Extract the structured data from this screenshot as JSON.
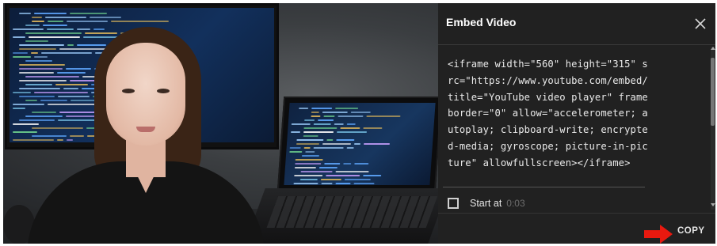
{
  "dialog": {
    "title": "Embed Video",
    "close_icon": "close-icon",
    "embed_code": "<iframe width=\"560\" height=\"315\" src=\"https://www.youtube.com/embed/ title=\"YouTube video player\" frameborder=\"0\" allow=\"accelerometer; autoplay; clipboard-write; encrypted-media; gyroscope; picture-in-picture\" allowfullscreen></iframe>",
    "start_at": {
      "label": "Start at",
      "time": "0:03",
      "checked": false
    },
    "copy_label": "COPY",
    "annotation_arrow": "red-arrow-icon"
  },
  "colors": {
    "panel_bg": "#212121",
    "arrow": "#e8190f",
    "text": "#eaeaea"
  }
}
